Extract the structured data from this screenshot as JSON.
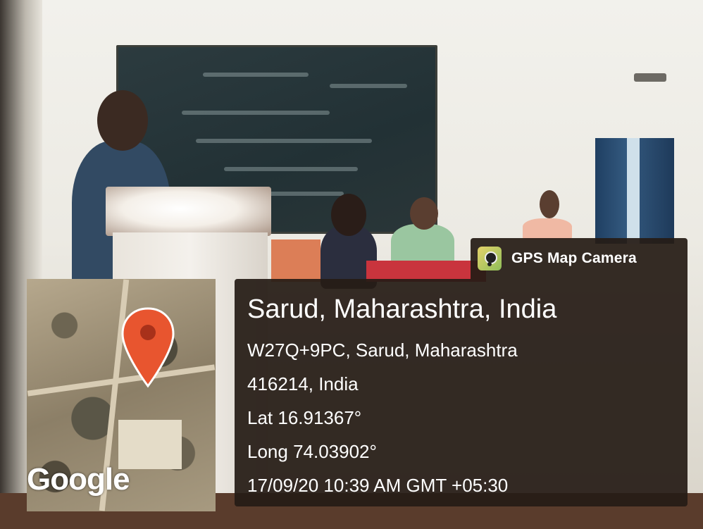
{
  "app": {
    "brand_label": "GPS Map Camera",
    "brand_icon": "camera-pin-icon"
  },
  "location": {
    "title": "Sarud, Maharashtra, India",
    "address_line1": "W27Q+9PC, Sarud, Maharashtra",
    "address_line2": "416214, India",
    "latitude": "Lat 16.91367°",
    "longitude": "Long 74.03902°",
    "timestamp": "17/09/20 10:39 AM GMT +05:30"
  },
  "map": {
    "attribution": "Google",
    "marker_icon": "map-pin-icon",
    "marker_color": "#e8552f"
  },
  "colors": {
    "overlay_bg": "#261c16",
    "text": "#ffffff"
  }
}
